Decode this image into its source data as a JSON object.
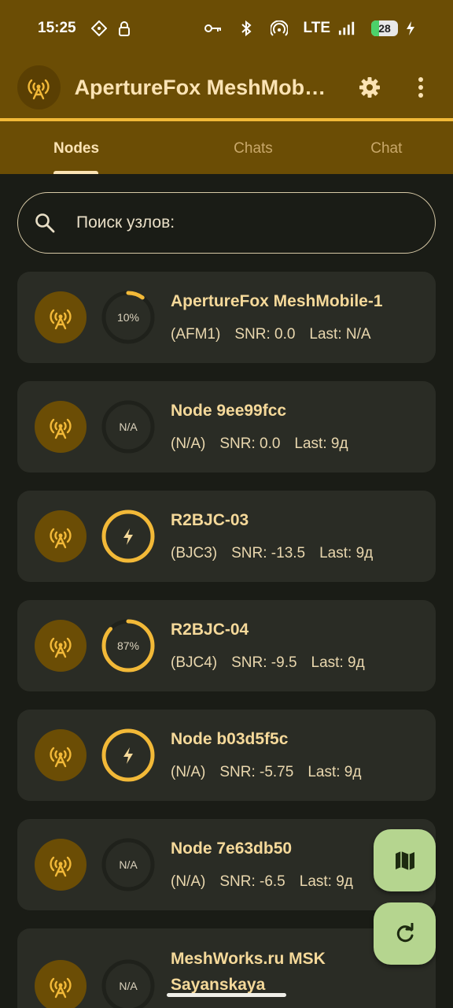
{
  "status_bar": {
    "time": "15:25",
    "network": "LTE",
    "battery_level": "28",
    "battery_fraction": 0.28
  },
  "app_bar": {
    "title": "ApertureFox MeshMobil…",
    "icons": [
      "antenna-icon",
      "gear-icon",
      "more-vert-icon"
    ]
  },
  "tabs": [
    {
      "label": "Nodes",
      "active": true
    },
    {
      "label": "Chats",
      "active": false
    },
    {
      "label": "Chat",
      "active": false
    }
  ],
  "search": {
    "placeholder": "Поиск узлов:"
  },
  "nodes": [
    {
      "name": "ApertureFox MeshMobile-1",
      "short": "(AFM1)",
      "snr": "SNR: 0.0",
      "last": "Last: N/A",
      "battery": "10%",
      "battery_fraction": 0.1,
      "mode": "percent"
    },
    {
      "name": "Node 9ee99fcc",
      "short": "(N/A)",
      "snr": "SNR: 0.0",
      "last": "Last: 9д",
      "battery": "N/A",
      "battery_fraction": 0,
      "mode": "na"
    },
    {
      "name": "R2BJC-03",
      "short": "(BJC3)",
      "snr": "SNR: -13.5",
      "last": "Last: 9д",
      "battery": "",
      "battery_fraction": 1,
      "mode": "charging"
    },
    {
      "name": "R2BJC-04",
      "short": "(BJC4)",
      "snr": "SNR: -9.5",
      "last": "Last: 9д",
      "battery": "87%",
      "battery_fraction": 0.87,
      "mode": "percent"
    },
    {
      "name": "Node b03d5f5c",
      "short": "(N/A)",
      "snr": "SNR: -5.75",
      "last": "Last: 9д",
      "battery": "",
      "battery_fraction": 1,
      "mode": "charging"
    },
    {
      "name": "Node 7e63db50",
      "short": "(N/A)",
      "snr": "SNR: -6.5",
      "last": "Last: 9д",
      "battery": "N/A",
      "battery_fraction": 0,
      "mode": "na"
    },
    {
      "name": "MeshWorks.ru MSK Sayanskaya",
      "short": "",
      "snr": "",
      "last": "",
      "battery": "N/A",
      "battery_fraction": 0,
      "mode": "na"
    }
  ],
  "fabs": {
    "map_icon": "map-icon",
    "refresh_icon": "refresh-icon"
  },
  "colors": {
    "accent": "#f2b938",
    "appbar": "#6b4d05",
    "card": "#2a2c25",
    "fab": "#b5d58f"
  }
}
